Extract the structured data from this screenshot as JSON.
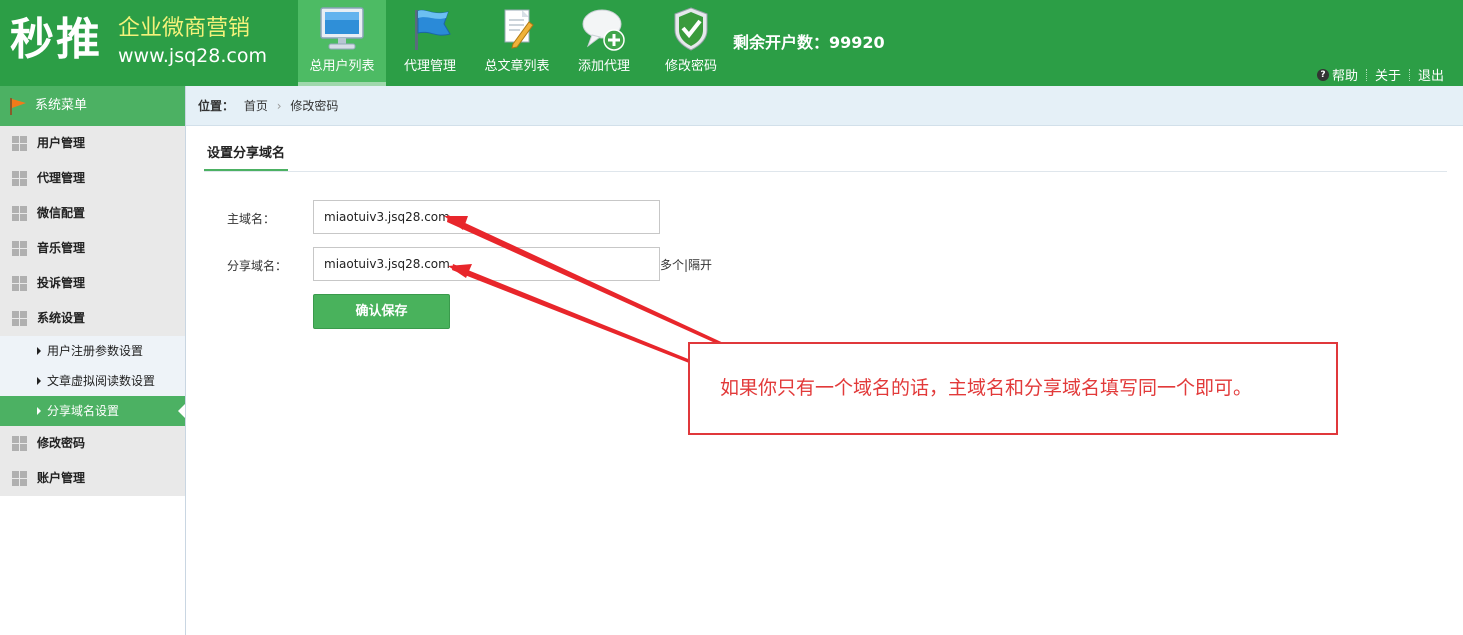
{
  "brand": {
    "logo_main": "秒推",
    "logo_sub": "企业微商营销",
    "logo_url": "www.jsq28.com"
  },
  "nav": [
    {
      "label": "总用户列表",
      "icon": "monitor-icon",
      "active": true
    },
    {
      "label": "代理管理",
      "icon": "flag-icon",
      "active": false
    },
    {
      "label": "总文章列表",
      "icon": "document-edit-icon",
      "active": false
    },
    {
      "label": "添加代理",
      "icon": "chat-bubble-add-icon",
      "active": false
    },
    {
      "label": "修改密码",
      "icon": "shield-check-icon",
      "active": false
    }
  ],
  "remaining_accounts": "剩余开户数：99920",
  "toplinks": {
    "help": "帮助",
    "about": "关于",
    "logout": "退出"
  },
  "sidebar": {
    "title": "系统菜单",
    "groups": [
      {
        "label": "用户管理"
      },
      {
        "label": "代理管理"
      },
      {
        "label": "微信配置"
      },
      {
        "label": "音乐管理"
      },
      {
        "label": "投诉管理"
      },
      {
        "label": "系统设置",
        "children": [
          {
            "label": "用户注册参数设置",
            "active": false
          },
          {
            "label": "文章虚拟阅读数设置",
            "active": false
          },
          {
            "label": "分享域名设置",
            "active": true
          }
        ]
      },
      {
        "label": "修改密码"
      },
      {
        "label": "账户管理"
      }
    ]
  },
  "breadcrumb": {
    "prefix": "位置：",
    "home": "首页",
    "arrow": "›",
    "current": "修改密码"
  },
  "form": {
    "tab_title": "设置分享域名",
    "main_domain_label": "主域名：",
    "main_domain_value": "miaotuiv3.jsq28.com",
    "share_domain_label": "分享域名：",
    "share_domain_value": "miaotuiv3.jsq28.com",
    "share_domain_hint": "多个|隔开",
    "save_button": "确认保存"
  },
  "annotation": {
    "note": "如果你只有一个域名的话，主域名和分享域名填写同一个即可。",
    "color": "#e23a3a"
  },
  "colors": {
    "header": "#2c9e46",
    "accent": "#4cb163"
  }
}
